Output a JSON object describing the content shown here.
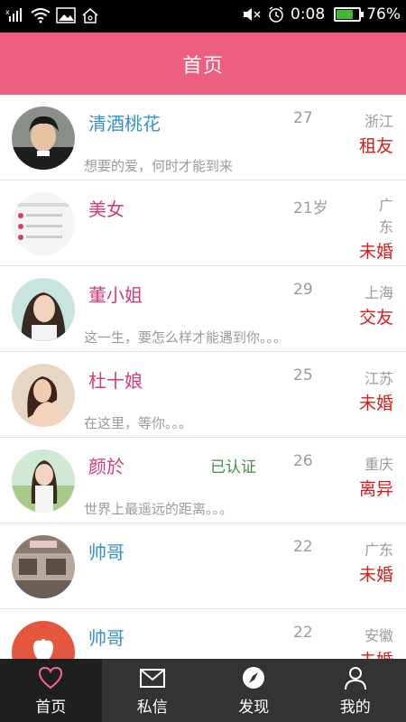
{
  "status_bar": {
    "time": "0:08",
    "battery_percent": "76%",
    "battery_level": 0.76,
    "icons": [
      "signal-icon",
      "wifi-icon",
      "image-icon",
      "home-icon",
      "mute-icon",
      "alarm-icon",
      "battery-icon"
    ]
  },
  "header": {
    "title": "首页"
  },
  "users": [
    {
      "name": "清酒桃花",
      "name_color": "#3a8fc7",
      "badge": "",
      "age": "27",
      "location": "浙江",
      "status": "租友",
      "motto": "想要的爱，何时才能到来"
    },
    {
      "name": "美女",
      "name_color": "#d33a7a",
      "badge": "",
      "age": "21岁",
      "location": "广东",
      "status": "未婚",
      "motto": ""
    },
    {
      "name": "董小姐",
      "name_color": "#d33a7a",
      "badge": "",
      "age": "29",
      "location": "上海",
      "status": "交友",
      "motto": "这一生，要怎么样才能遇到你。。。"
    },
    {
      "name": "杜十娘",
      "name_color": "#d33a7a",
      "badge": "",
      "age": "25",
      "location": "江苏",
      "status": "未婚",
      "motto": "在这里，等你。。。"
    },
    {
      "name": "颜於",
      "name_color": "#d33a7a",
      "badge": "已认证",
      "age": "26",
      "location": "重庆",
      "status": "离异",
      "motto": "世界上最遥远的距离。。。"
    },
    {
      "name": "帅哥",
      "name_color": "#3a8fc7",
      "badge": "",
      "age": "22",
      "location": "广东",
      "status": "未婚",
      "motto": ""
    },
    {
      "name": "帅哥",
      "name_color": "#3a8fc7",
      "badge": "",
      "age": "22",
      "location": "安徽",
      "status": "未婚",
      "motto": ""
    }
  ],
  "bottom_nav": {
    "items": [
      {
        "label": "首页",
        "icon": "heart-icon",
        "active": true
      },
      {
        "label": "私信",
        "icon": "mail-icon",
        "active": false
      },
      {
        "label": "发现",
        "icon": "compass-icon",
        "active": false
      },
      {
        "label": "我的",
        "icon": "person-icon",
        "active": false
      }
    ]
  },
  "colors": {
    "accent": "#ec5f80",
    "status_red": "#d61b1b",
    "badge_green": "#3e8f44",
    "nav_bg": "#333333"
  }
}
